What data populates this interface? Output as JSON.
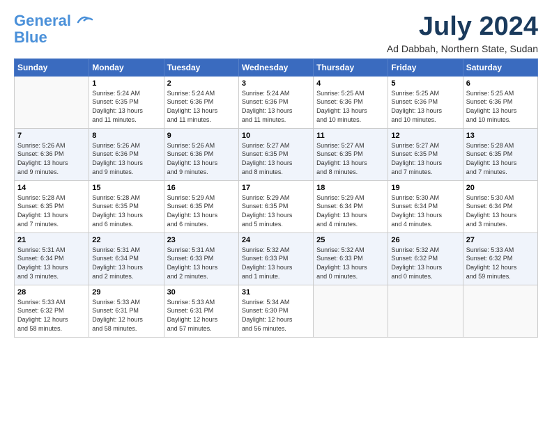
{
  "logo": {
    "line1": "General",
    "line2": "Blue"
  },
  "title": "July 2024",
  "subtitle": "Ad Dabbah, Northern State, Sudan",
  "weekdays": [
    "Sunday",
    "Monday",
    "Tuesday",
    "Wednesday",
    "Thursday",
    "Friday",
    "Saturday"
  ],
  "weeks": [
    [
      {
        "day": "",
        "content": ""
      },
      {
        "day": "1",
        "content": "Sunrise: 5:24 AM\nSunset: 6:35 PM\nDaylight: 13 hours\nand 11 minutes."
      },
      {
        "day": "2",
        "content": "Sunrise: 5:24 AM\nSunset: 6:36 PM\nDaylight: 13 hours\nand 11 minutes."
      },
      {
        "day": "3",
        "content": "Sunrise: 5:24 AM\nSunset: 6:36 PM\nDaylight: 13 hours\nand 11 minutes."
      },
      {
        "day": "4",
        "content": "Sunrise: 5:25 AM\nSunset: 6:36 PM\nDaylight: 13 hours\nand 10 minutes."
      },
      {
        "day": "5",
        "content": "Sunrise: 5:25 AM\nSunset: 6:36 PM\nDaylight: 13 hours\nand 10 minutes."
      },
      {
        "day": "6",
        "content": "Sunrise: 5:25 AM\nSunset: 6:36 PM\nDaylight: 13 hours\nand 10 minutes."
      }
    ],
    [
      {
        "day": "7",
        "content": "Sunrise: 5:26 AM\nSunset: 6:36 PM\nDaylight: 13 hours\nand 9 minutes."
      },
      {
        "day": "8",
        "content": "Sunrise: 5:26 AM\nSunset: 6:36 PM\nDaylight: 13 hours\nand 9 minutes."
      },
      {
        "day": "9",
        "content": "Sunrise: 5:26 AM\nSunset: 6:36 PM\nDaylight: 13 hours\nand 9 minutes."
      },
      {
        "day": "10",
        "content": "Sunrise: 5:27 AM\nSunset: 6:35 PM\nDaylight: 13 hours\nand 8 minutes."
      },
      {
        "day": "11",
        "content": "Sunrise: 5:27 AM\nSunset: 6:35 PM\nDaylight: 13 hours\nand 8 minutes."
      },
      {
        "day": "12",
        "content": "Sunrise: 5:27 AM\nSunset: 6:35 PM\nDaylight: 13 hours\nand 7 minutes."
      },
      {
        "day": "13",
        "content": "Sunrise: 5:28 AM\nSunset: 6:35 PM\nDaylight: 13 hours\nand 7 minutes."
      }
    ],
    [
      {
        "day": "14",
        "content": "Sunrise: 5:28 AM\nSunset: 6:35 PM\nDaylight: 13 hours\nand 7 minutes."
      },
      {
        "day": "15",
        "content": "Sunrise: 5:28 AM\nSunset: 6:35 PM\nDaylight: 13 hours\nand 6 minutes."
      },
      {
        "day": "16",
        "content": "Sunrise: 5:29 AM\nSunset: 6:35 PM\nDaylight: 13 hours\nand 6 minutes."
      },
      {
        "day": "17",
        "content": "Sunrise: 5:29 AM\nSunset: 6:35 PM\nDaylight: 13 hours\nand 5 minutes."
      },
      {
        "day": "18",
        "content": "Sunrise: 5:29 AM\nSunset: 6:34 PM\nDaylight: 13 hours\nand 4 minutes."
      },
      {
        "day": "19",
        "content": "Sunrise: 5:30 AM\nSunset: 6:34 PM\nDaylight: 13 hours\nand 4 minutes."
      },
      {
        "day": "20",
        "content": "Sunrise: 5:30 AM\nSunset: 6:34 PM\nDaylight: 13 hours\nand 3 minutes."
      }
    ],
    [
      {
        "day": "21",
        "content": "Sunrise: 5:31 AM\nSunset: 6:34 PM\nDaylight: 13 hours\nand 3 minutes."
      },
      {
        "day": "22",
        "content": "Sunrise: 5:31 AM\nSunset: 6:34 PM\nDaylight: 13 hours\nand 2 minutes."
      },
      {
        "day": "23",
        "content": "Sunrise: 5:31 AM\nSunset: 6:33 PM\nDaylight: 13 hours\nand 2 minutes."
      },
      {
        "day": "24",
        "content": "Sunrise: 5:32 AM\nSunset: 6:33 PM\nDaylight: 13 hours\nand 1 minute."
      },
      {
        "day": "25",
        "content": "Sunrise: 5:32 AM\nSunset: 6:33 PM\nDaylight: 13 hours\nand 0 minutes."
      },
      {
        "day": "26",
        "content": "Sunrise: 5:32 AM\nSunset: 6:32 PM\nDaylight: 13 hours\nand 0 minutes."
      },
      {
        "day": "27",
        "content": "Sunrise: 5:33 AM\nSunset: 6:32 PM\nDaylight: 12 hours\nand 59 minutes."
      }
    ],
    [
      {
        "day": "28",
        "content": "Sunrise: 5:33 AM\nSunset: 6:32 PM\nDaylight: 12 hours\nand 58 minutes."
      },
      {
        "day": "29",
        "content": "Sunrise: 5:33 AM\nSunset: 6:31 PM\nDaylight: 12 hours\nand 58 minutes."
      },
      {
        "day": "30",
        "content": "Sunrise: 5:33 AM\nSunset: 6:31 PM\nDaylight: 12 hours\nand 57 minutes."
      },
      {
        "day": "31",
        "content": "Sunrise: 5:34 AM\nSunset: 6:30 PM\nDaylight: 12 hours\nand 56 minutes."
      },
      {
        "day": "",
        "content": ""
      },
      {
        "day": "",
        "content": ""
      },
      {
        "day": "",
        "content": ""
      }
    ]
  ]
}
